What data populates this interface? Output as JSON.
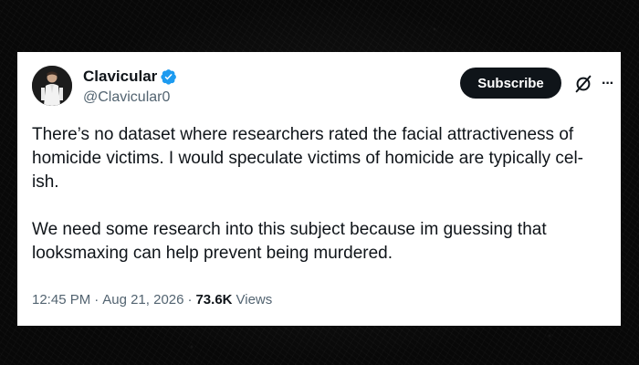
{
  "author": {
    "display_name": "Clavicular",
    "handle": "@Clavicular0",
    "verified": true,
    "verified_color": "#1d9bf0"
  },
  "actions": {
    "subscribe_label": "Subscribe",
    "grok_icon": "grok-icon",
    "more_icon": "more-icon",
    "more_glyph": "···"
  },
  "tweet": {
    "paragraph_1": "There’s no dataset where researchers rated the facial attractiveness of homicide victims. I would speculate victims of homicide are typically cel-ish.",
    "paragraph_2": "We need some research into this subject because im guessing that looksmaxing can help prevent being murdered."
  },
  "meta": {
    "time": "12:45 PM",
    "separator": "·",
    "date": "Aug 21, 2026",
    "views_count": "73.6K",
    "views_label": "Views"
  },
  "colors": {
    "background": "#0b0b0b",
    "card": "#ffffff",
    "text_primary": "#0f1419",
    "text_secondary": "#536471",
    "button": "#0f1419"
  }
}
